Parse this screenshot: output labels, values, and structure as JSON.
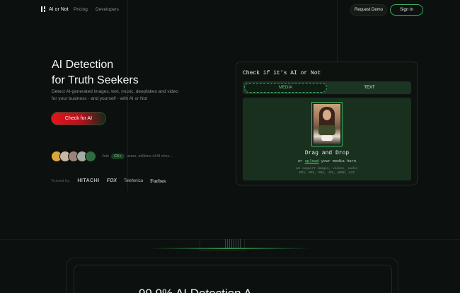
{
  "nav": {
    "brand": "AI or Not",
    "links": [
      "Pricing",
      "Developers"
    ],
    "request_demo": "Request Demo",
    "sign_in": "Sign In"
  },
  "hero": {
    "title_line1": "AI Detection",
    "title_line2": "for Truth Seekers",
    "subtitle": "Detect AI-generated images, text, music, deepfakes and video for your business - and yourself - with AI or Not",
    "cta": "Check for AI",
    "social_join": "Join",
    "social_count": "CK+",
    "social_rest": "users, millions of AI chec..."
  },
  "trusted": {
    "label": "Trusted by:",
    "brands": [
      "HITACHI",
      "FOX",
      "Telefonica",
      "Forbes"
    ]
  },
  "checker": {
    "title": "Check if it's AI or Not",
    "tab_media": "MEDIA",
    "tab_text": "TEXT",
    "drag_title": "Drag and Drop",
    "drag_sub_prefix": "or",
    "drag_sub_link": "upload",
    "drag_sub_suffix": "your media here",
    "note_line1": "We support images, videos, audio",
    "note_line2": "MP3, MP4, PNG, JPG, WEBP, GIF"
  },
  "bottom": {
    "heading": "99.9% AI Detection A..."
  },
  "colors": {
    "accent_green": "#3fae5d",
    "cta_red": "#e3141c",
    "background": "#0c100e"
  }
}
